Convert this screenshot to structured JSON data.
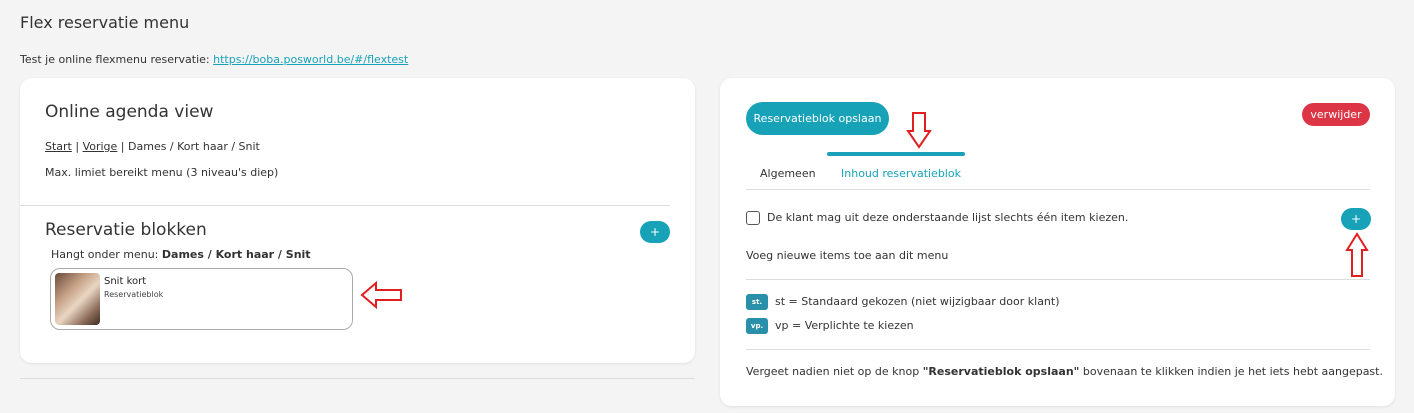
{
  "page": {
    "title": "Flex reservatie menu",
    "test_prefix": "Test je online flexmenu reservatie: ",
    "test_link": "https://boba.posworld.be/#/flextest"
  },
  "left": {
    "agenda_title": "Online agenda view",
    "crumbs": {
      "start": "Start",
      "sep1": " | ",
      "previous": "Vorige",
      "sep2": " | ",
      "current": "Dames / Kort haar / Snit"
    },
    "limit_text": "Max. limiet bereikt menu (3 niveau's diep)",
    "blocks_title": "Reservatie blokken",
    "add_label": "+",
    "hangs_prefix": "Hangt onder menu: ",
    "hangs_value": "Dames / Kort haar / Snit",
    "block": {
      "title": "Snit kort",
      "subtitle": "Reservatieblok"
    }
  },
  "right": {
    "save_label": "Reservatieblok opslaan",
    "delete_label": "verwijder",
    "tabs": [
      {
        "label": "Algemeen"
      },
      {
        "label": "Inhoud reservatieblok"
      }
    ],
    "checkbox_label": "De klant mag uit deze onderstaande lijst slechts één item kiezen.",
    "add_label": "+",
    "add_items_text": "Voeg nieuwe items toe aan dit menu",
    "legend": [
      {
        "badge": "st.",
        "text": "st = Standaard gekozen (niet wijzigbaar door klant)"
      },
      {
        "badge": "vp.",
        "text": "vp = Verplichte te kiezen"
      }
    ],
    "note": {
      "prefix": "Vergeet nadien niet op de knop ",
      "bold": "\"Reservatieblok opslaan\"",
      "suffix": " bovenaan te klikken indien je het iets hebt aangepast."
    }
  },
  "colors": {
    "accent": "#17a2b8",
    "danger": "#dc3545",
    "annotation": "#e02020"
  }
}
